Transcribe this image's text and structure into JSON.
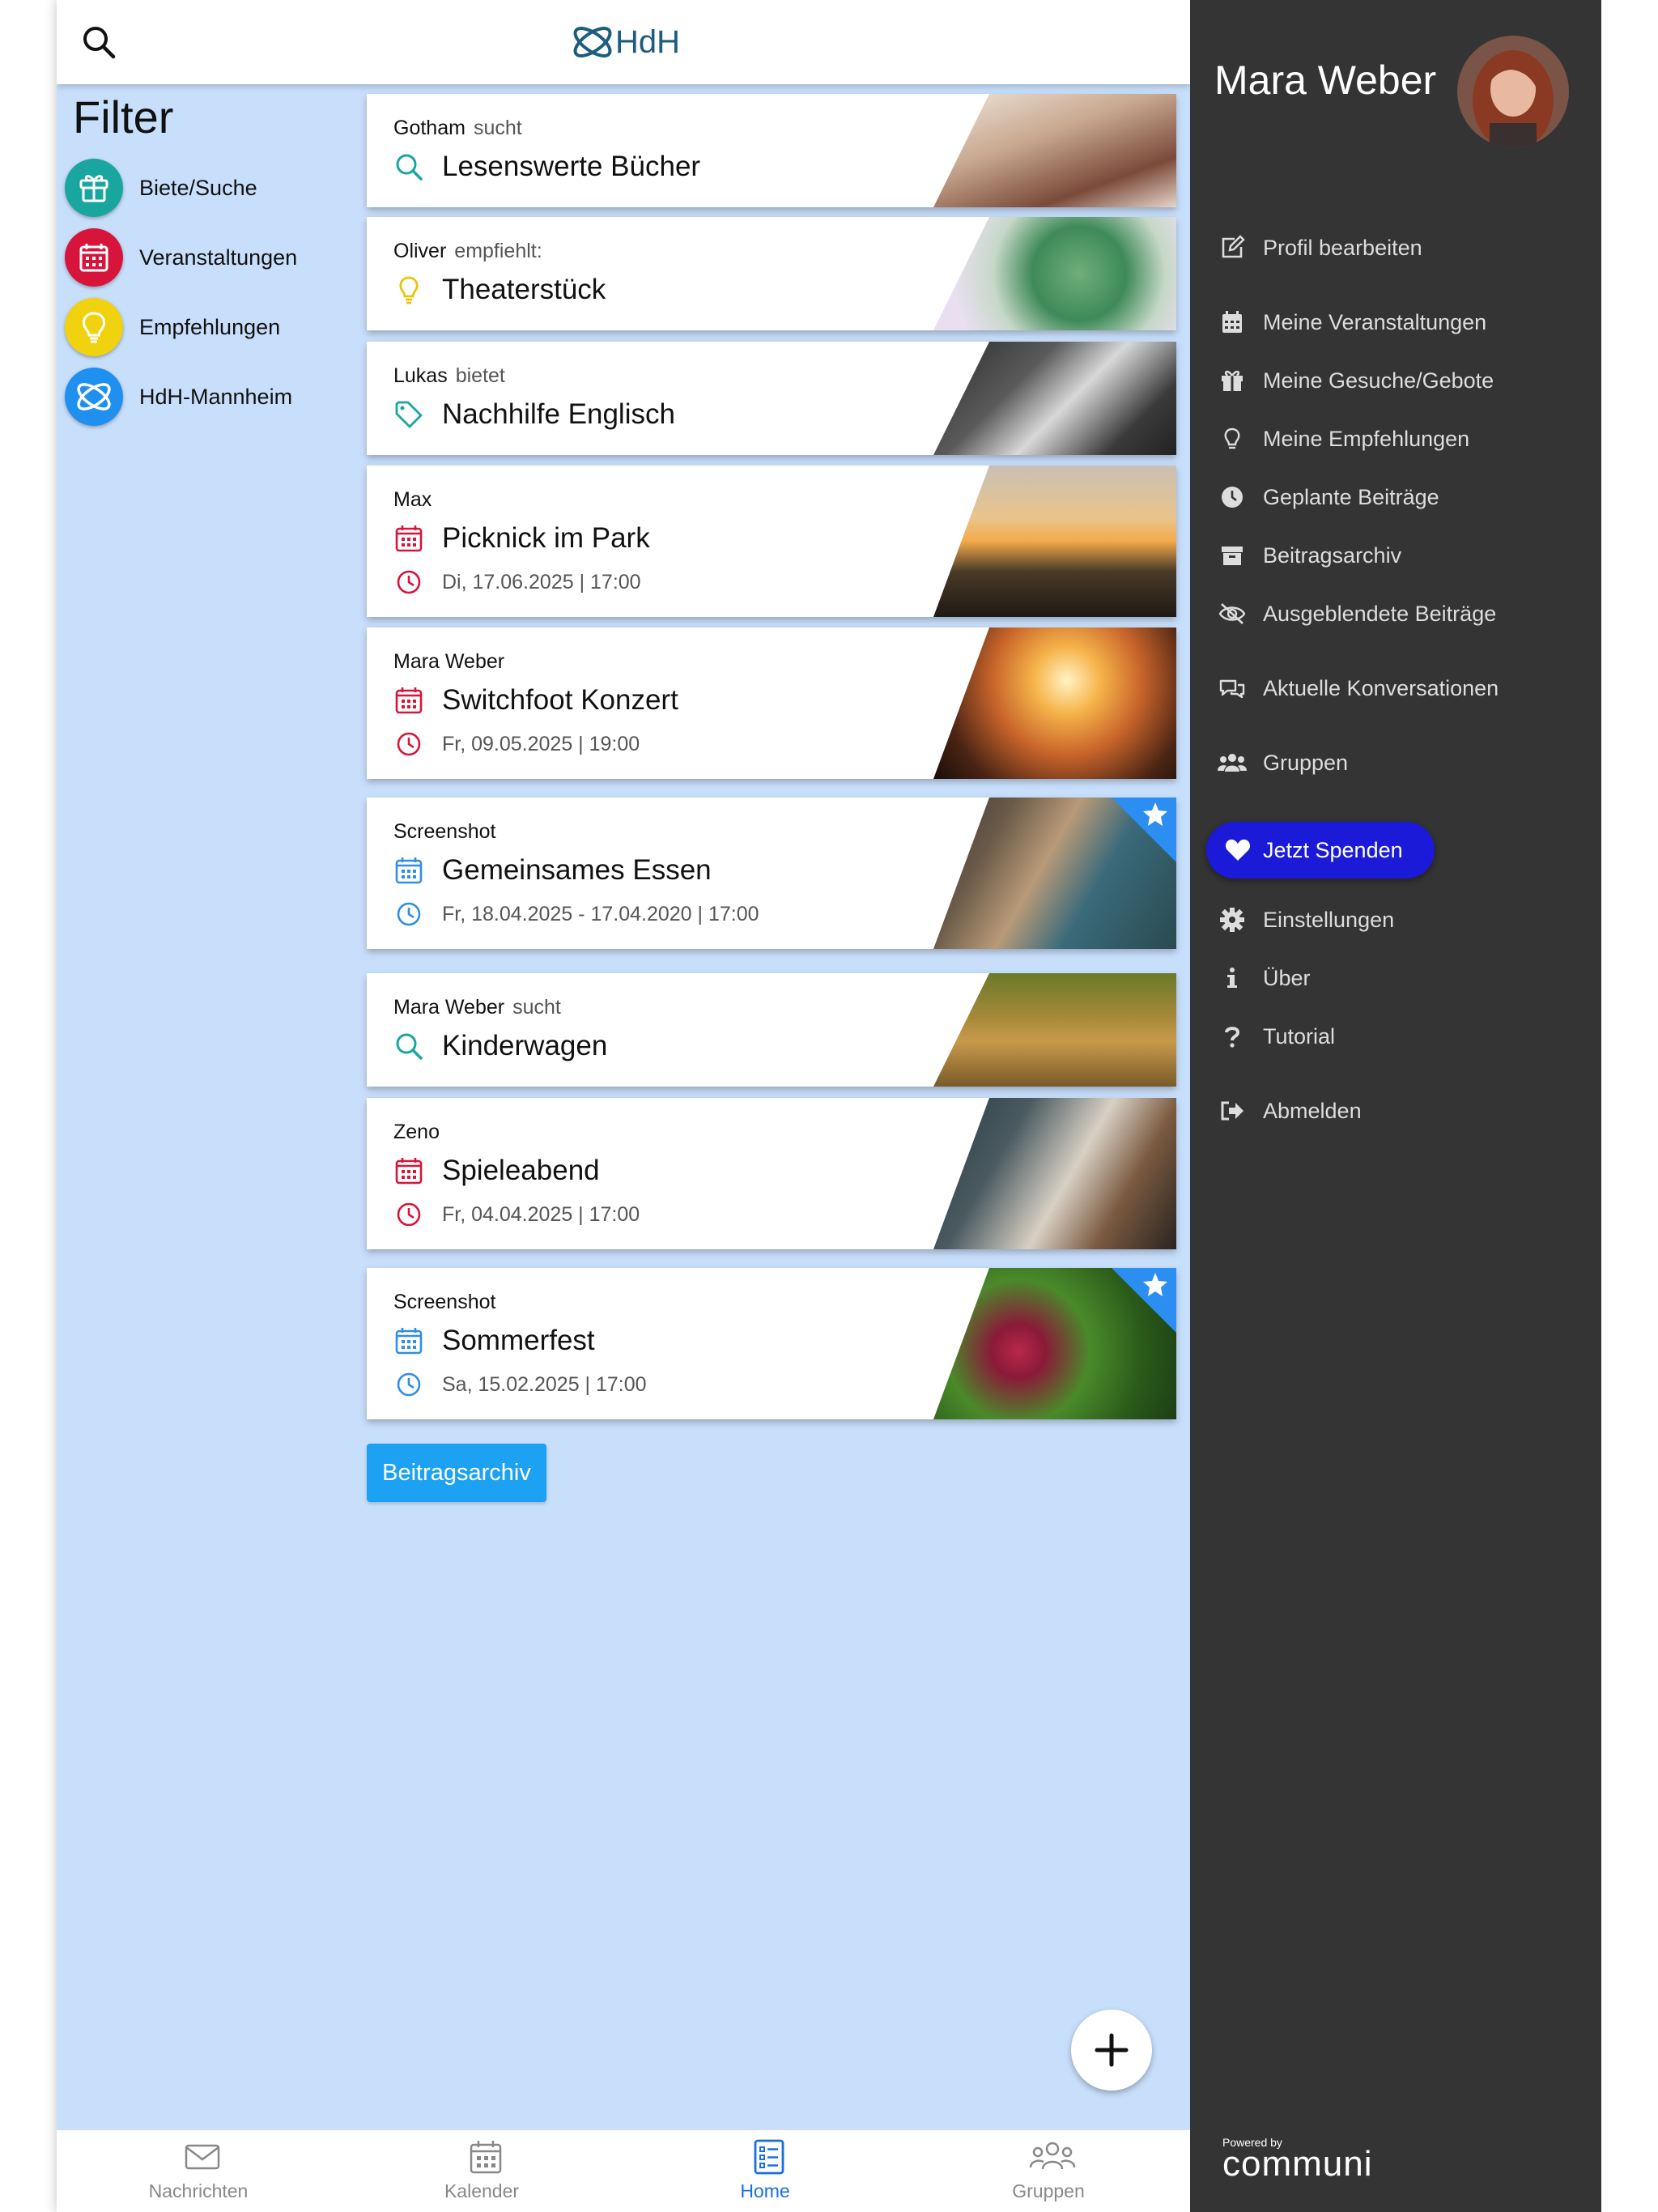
{
  "header": {
    "logo_text": "HdH"
  },
  "filter": {
    "title": "Filter",
    "items": [
      {
        "label": "Biete/Suche",
        "color": "#1aa6a0"
      },
      {
        "label": "Veranstaltungen",
        "color": "#d7153a"
      },
      {
        "label": "Empfehlungen",
        "color": "#f0d20e"
      },
      {
        "label": "HdH-Mannheim",
        "color": "#1f8ff0"
      }
    ]
  },
  "posts": [
    {
      "author": "Gotham",
      "verb": "sucht",
      "title": "Lesenswerte Bücher",
      "icon": "search-icon",
      "date": ""
    },
    {
      "author": "Oliver",
      "verb": "empfiehlt:",
      "title": "Theaterstück",
      "icon": "lightbulb-icon",
      "date": ""
    },
    {
      "author": "Lukas",
      "verb": "bietet",
      "title": "Nachhilfe Englisch",
      "icon": "tag-icon",
      "date": ""
    },
    {
      "author": "Max",
      "verb": "",
      "title": "Picknick im Park",
      "icon": "calendar-icon",
      "date": "Di, 17.06.2025 | 17:00"
    },
    {
      "author": "Mara Weber",
      "verb": "",
      "title": "Switchfoot Konzert",
      "icon": "calendar-icon",
      "date": "Fr, 09.05.2025 | 19:00"
    },
    {
      "author": "Screenshot",
      "verb": "",
      "title": "Gemeinsames Essen",
      "icon": "calendar-icon",
      "date": "Fr, 18.04.2025 - 17.04.2020 | 17:00",
      "starred": true
    },
    {
      "author": "Mara Weber",
      "verb": "sucht",
      "title": "Kinderwagen",
      "icon": "search-icon",
      "date": ""
    },
    {
      "author": "Zeno",
      "verb": "",
      "title": "Spieleabend",
      "icon": "calendar-icon",
      "date": "Fr, 04.04.2025 | 17:00"
    },
    {
      "author": "Screenshot",
      "verb": "",
      "title": "Sommerfest",
      "icon": "calendar-icon",
      "date": "Sa, 15.02.2025 | 17:00",
      "starred": true
    }
  ],
  "archive_button": "Beitragsarchiv",
  "bottom_nav": [
    {
      "label": "Nachrichten",
      "icon": "envelope-icon"
    },
    {
      "label": "Kalender",
      "icon": "calendar-icon"
    },
    {
      "label": "Home",
      "icon": "list-icon",
      "active": true
    },
    {
      "label": "Gruppen",
      "icon": "users-icon"
    }
  ],
  "sidebar": {
    "user_name": "Mara Weber",
    "menu": [
      {
        "label": "Profil bearbeiten",
        "icon": "edit-icon"
      },
      {
        "label": "Meine Veranstaltungen",
        "icon": "calendar-icon"
      },
      {
        "label": "Meine Gesuche/Gebote",
        "icon": "gift-icon"
      },
      {
        "label": "Meine Empfehlungen",
        "icon": "lightbulb-icon"
      },
      {
        "label": "Geplante Beiträge",
        "icon": "clock-icon"
      },
      {
        "label": "Beitragsarchiv",
        "icon": "archive-icon"
      },
      {
        "label": "Ausgeblendete Beiträge",
        "icon": "eye-slash-icon"
      },
      {
        "label": "Aktuelle Konversationen",
        "icon": "chat-icon"
      },
      {
        "label": "Gruppen",
        "icon": "users-icon"
      },
      {
        "label": "Einstellungen",
        "icon": "gear-icon"
      },
      {
        "label": "Über",
        "icon": "info-icon"
      },
      {
        "label": "Tutorial",
        "icon": "question-icon"
      },
      {
        "label": "Abmelden",
        "icon": "logout-icon"
      }
    ],
    "donate_label": "Jetzt Spenden",
    "powered_by": "Powered by",
    "brand": "communi"
  },
  "colors": {
    "accent": "#1da1f2",
    "event_red": "#d7153a",
    "event_blue": "#2f8ee8",
    "teal": "#1aa6a0",
    "bulb_yellow": "#f0d20e",
    "sidebar_bg": "#343434",
    "donate": "#1a1ad8",
    "content_bg": "#c8dffc"
  }
}
